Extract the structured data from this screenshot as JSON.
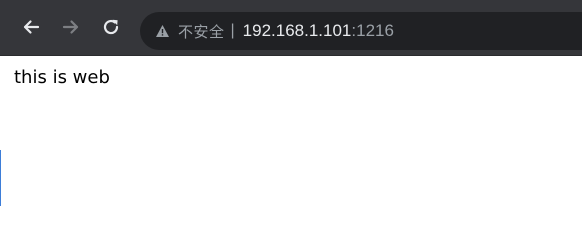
{
  "toolbar": {
    "back_icon": "arrow-left-icon",
    "forward_icon": "arrow-right-icon",
    "reload_icon": "reload-icon",
    "colors": {
      "background": "#35363a",
      "omnibox": "#202124",
      "active_icon": "#e8eaed",
      "disabled_icon": "#7d7f83"
    }
  },
  "address_bar": {
    "security_icon": "warning-triangle-icon",
    "security_label": "不安全",
    "separator": "|",
    "url_host": "192.168.1.101",
    "url_port": ":1216"
  },
  "page": {
    "body_text": "this is web"
  }
}
